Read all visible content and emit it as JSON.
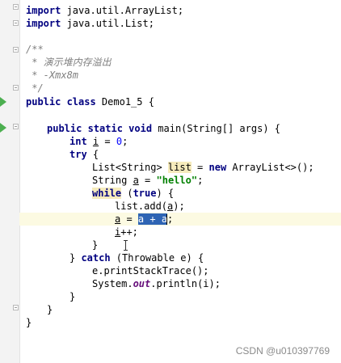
{
  "editor": {
    "lines": {
      "l1": {
        "kw": "import",
        "rest": " java.util.ArrayList;"
      },
      "l2": {
        "kw": "import",
        "rest": " java.util.List;"
      },
      "l4": "/**",
      "l5": " * 演示堆内存溢出",
      "l6": " * -Xmx8m",
      "l7": " */",
      "l8": {
        "kw": "public class",
        "rest": " Demo1_5 {"
      },
      "l10": {
        "kw": "public static void",
        "rest": " main(String[] args) {"
      },
      "l11": {
        "kw": "int",
        "var": "i",
        "mid": " = ",
        "num": "0",
        "end": ";"
      },
      "l12": {
        "kw": "try",
        "rest": " {"
      },
      "l13": {
        "pre": "List<String> ",
        "hl": "list",
        "mid": " = ",
        "kw": "new",
        "rest": " ArrayList<>();"
      },
      "l14": {
        "pre": "String ",
        "var": "a",
        "mid": " = ",
        "str": "\"hello\"",
        "end": ";"
      },
      "l15": {
        "kw": "while",
        "mid": " (",
        "kw2": "true",
        "end": ") {"
      },
      "l16": {
        "pre": "list.add(",
        "var": "a",
        "end": ");"
      },
      "l17": {
        "var": "a",
        "mid": " = ",
        "sel": "a + a",
        "end": ";"
      },
      "l18": {
        "var": "i",
        "end": "++;"
      },
      "l19": "}",
      "l20": {
        "pre": "} ",
        "kw": "catch",
        "rest": " (Throwable e) {"
      },
      "l21": "e.printStackTrace();",
      "l22": {
        "pre": "System.",
        "it": "out",
        "rest": ".println(i);"
      },
      "l23": "}",
      "l24": "}",
      "l25": "}"
    }
  },
  "watermark": "CSDN @u010397769",
  "icons": [
    "run-class-icon",
    "run-method-icon",
    "intention-bulb-icon",
    "fold-marker-icon",
    "text-cursor-icon"
  ],
  "colors": {
    "keyword": "#000080",
    "number": "#0000ff",
    "string": "#008000",
    "comment": "#808080",
    "selection": "#2e64b4",
    "current_line": "#fcfae2"
  }
}
